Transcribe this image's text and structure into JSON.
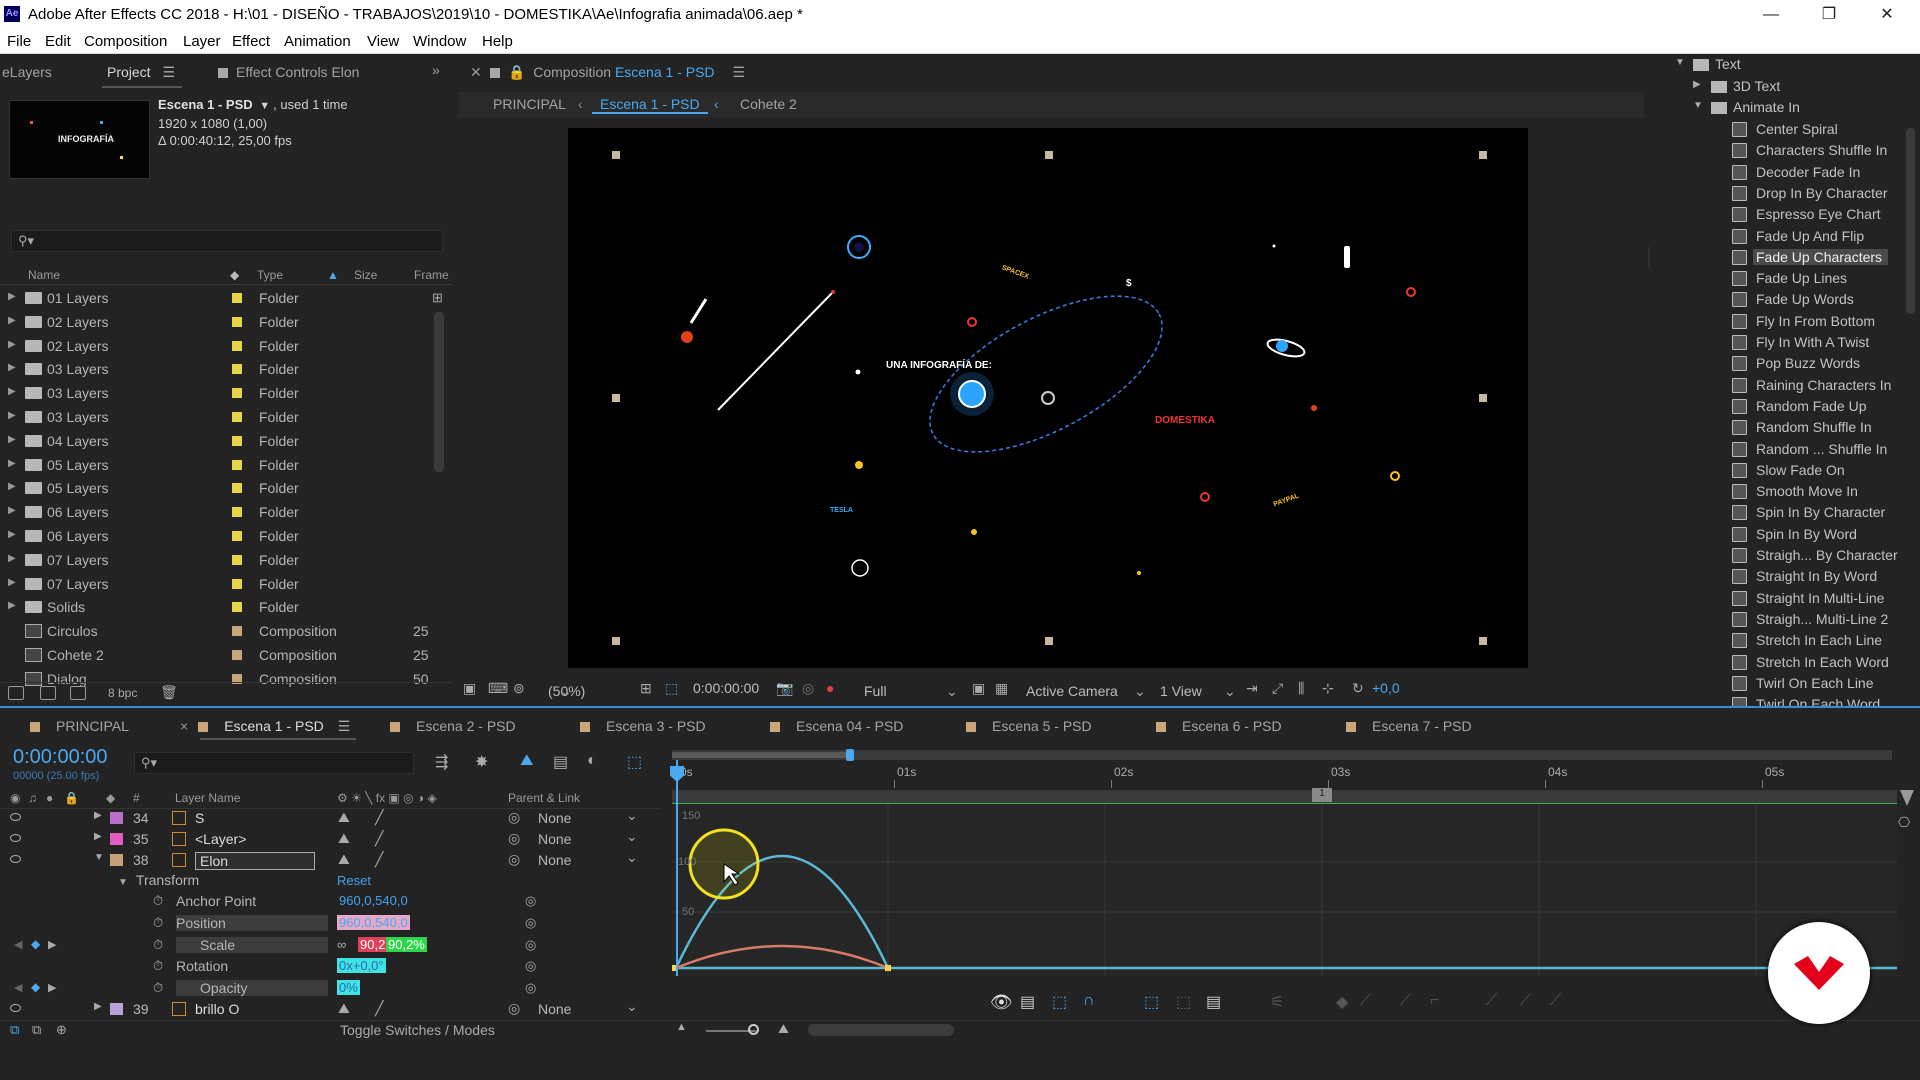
{
  "app": {
    "title": "Adobe After Effects CC 2018 - H:\\01 - DISEÑO - TRABAJOS\\2019\\10 - DOMESTIKA\\Ae\\Infografia animada\\06.aep *",
    "icon": "Ae"
  },
  "window_controls": {
    "minimize": "—",
    "maximize": "❐",
    "close": "✕"
  },
  "menu": [
    "File",
    "Edit",
    "Composition",
    "Layer",
    "Effect",
    "Animation",
    "View",
    "Window",
    "Help"
  ],
  "project_panel": {
    "tabs": {
      "layers": "eLayers",
      "project": "Project",
      "effect_controls": "Effect Controls Elon"
    },
    "selected_item": {
      "name": "Escena 1 - PSD",
      "usage": ", used 1 time",
      "dims": "1920 x 1080 (1,00)",
      "duration": "Δ 0:00:40:12, 25,00 fps"
    },
    "thumbnail_text": "INFOGRAFÍA",
    "columns": {
      "name": "Name",
      "type": "Type",
      "size": "Size",
      "frame": "Frame"
    },
    "items": [
      {
        "name": "01 Layers",
        "type": "Folder",
        "kind": "folder",
        "frame": ""
      },
      {
        "name": "02 Layers",
        "type": "Folder",
        "kind": "folder",
        "frame": ""
      },
      {
        "name": "02 Layers",
        "type": "Folder",
        "kind": "folder",
        "frame": ""
      },
      {
        "name": "03 Layers",
        "type": "Folder",
        "kind": "folder",
        "frame": ""
      },
      {
        "name": "03 Layers",
        "type": "Folder",
        "kind": "folder",
        "frame": ""
      },
      {
        "name": "03 Layers",
        "type": "Folder",
        "kind": "folder",
        "frame": ""
      },
      {
        "name": "04 Layers",
        "type": "Folder",
        "kind": "folder",
        "frame": ""
      },
      {
        "name": "05 Layers",
        "type": "Folder",
        "kind": "folder",
        "frame": ""
      },
      {
        "name": "05 Layers",
        "type": "Folder",
        "kind": "folder",
        "frame": ""
      },
      {
        "name": "06 Layers",
        "type": "Folder",
        "kind": "folder",
        "frame": ""
      },
      {
        "name": "06 Layers",
        "type": "Folder",
        "kind": "folder",
        "frame": ""
      },
      {
        "name": "07 Layers",
        "type": "Folder",
        "kind": "folder",
        "frame": ""
      },
      {
        "name": "07 Layers",
        "type": "Folder",
        "kind": "folder",
        "frame": ""
      },
      {
        "name": "Solids",
        "type": "Folder",
        "kind": "folder",
        "frame": ""
      },
      {
        "name": "Circulos",
        "type": "Composition",
        "kind": "comp",
        "frame": "25"
      },
      {
        "name": "Cohete 2",
        "type": "Composition",
        "kind": "comp",
        "frame": "25"
      },
      {
        "name": "Dialog",
        "type": "Composition",
        "kind": "comp",
        "frame": "50"
      }
    ],
    "bpc": "8 bpc"
  },
  "composition_panel": {
    "title_prefix": "Composition",
    "title_comp": "Escena 1 - PSD",
    "breadcrumbs": [
      "PRINCIPAL",
      "Escena 1 - PSD",
      "Cohete 2"
    ],
    "canvas_labels": {
      "headline": "UNA INFOGRAFÍA DE:",
      "brand": "DOMESTIKA",
      "spacex": "SPACEX",
      "tesla": "TESLA",
      "paypal": "PAYPAL",
      "dollar": "$"
    },
    "toolbar": {
      "zoom": "(50%)",
      "time": "0:00:00:00",
      "resolution": "Full",
      "camera": "Active Camera",
      "views": "1 View",
      "exposure": "+0,0"
    }
  },
  "effects_panel": {
    "tree": [
      {
        "label": "Text",
        "level": 0,
        "expanded": true
      },
      {
        "label": "3D Text",
        "level": 1,
        "expanded": false
      },
      {
        "label": "Animate In",
        "level": 1,
        "expanded": true
      }
    ],
    "presets": [
      "Center Spiral",
      "Characters Shuffle In",
      "Decoder Fade In",
      "Drop In By Character",
      "Espresso Eye Chart",
      "Fade Up And Flip",
      "Fade Up Characters",
      "Fade Up Lines",
      "Fade Up Words",
      "Fly In From Bottom",
      "Fly In With A Twist",
      "Pop Buzz Words",
      "Raining Characters In",
      "Random Fade Up",
      "Random Shuffle In",
      "Random ... Shuffle In",
      "Slow Fade On",
      "Smooth Move In",
      "Spin In By Character",
      "Spin In By Word",
      "Straigh... By Character",
      "Straight In By Word",
      "Straight In Multi-Line",
      "Straigh... Multi-Line 2",
      "Stretch In Each Line",
      "Stretch In Each Word",
      "Twirl On Each Line",
      "Twirl On Each Word"
    ],
    "selected": "Fade Up Characters"
  },
  "timeline": {
    "tabs": [
      {
        "label": "PRINCIPAL",
        "color": "#c9a77a"
      },
      {
        "label": "Escena 1 - PSD",
        "color": "#c9a77a",
        "active": true
      },
      {
        "label": "Escena 2 - PSD",
        "color": "#c9a77a"
      },
      {
        "label": "Escena 3 - PSD",
        "color": "#c9a77a"
      },
      {
        "label": "Escena 04 - PSD",
        "color": "#c9a77a"
      },
      {
        "label": "Escena 5 - PSD",
        "color": "#c9a77a"
      },
      {
        "label": "Escena 6 - PSD",
        "color": "#c9a77a"
      },
      {
        "label": "Escena 7 - PSD",
        "color": "#c9a77a"
      }
    ],
    "timecode": "0:00:00:00",
    "timecode_sub": "00000 (25.00 fps)",
    "columns": {
      "num": "#",
      "layer_name": "Layer Name",
      "parent": "Parent & Link"
    },
    "layers": [
      {
        "num": "34",
        "name": "S",
        "color": "#b86fc9",
        "parent": "None"
      },
      {
        "num": "35",
        "name": "<Layer>",
        "color": "#e05ec0",
        "parent": "None"
      },
      {
        "num": "38",
        "name": "Elon",
        "color": "#c8a07a",
        "parent": "None",
        "selected": true
      },
      {
        "num": "39",
        "name": "brillo O",
        "color": "#b8a0d8",
        "parent": "None"
      }
    ],
    "transform": {
      "label": "Transform",
      "reset": "Reset",
      "props": [
        {
          "name": "Anchor Point",
          "value": "960,0,540,0"
        },
        {
          "name": "Position",
          "value": "960,0,540,0"
        },
        {
          "name": "Scale",
          "value_a": "90,2",
          "value_b": "90,2%"
        },
        {
          "name": "Rotation",
          "value": "0x+0,0°"
        },
        {
          "name": "Opacity",
          "value": "0%"
        }
      ]
    },
    "ruler": [
      "0s",
      "01s",
      "02s",
      "03s",
      "04s",
      "05s"
    ],
    "graph_labels": [
      "150",
      "100",
      "50"
    ],
    "footer": "Toggle Switches / Modes"
  },
  "colors": {
    "accent_blue": "#45a0ef",
    "label_yellow": "#e6d54a",
    "label_tan": "#c9a77a",
    "curve_blue": "#5bb8d6",
    "curve_red": "#d67a6a"
  }
}
